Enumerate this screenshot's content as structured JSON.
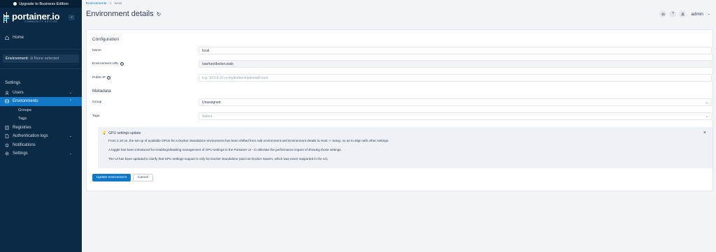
{
  "sidebar": {
    "upgrade_label": "Upgrade to Business Edition",
    "brand": {
      "name": "portainer.io",
      "edition": "COMMUNITY EDITION",
      "collapse_icon": "double-chevron-left-icon"
    },
    "home": "Home",
    "environment_label": "Environment:",
    "environment_value": "None selected",
    "settings_section": "Settings",
    "items": {
      "users": "Users",
      "environments": "Environments",
      "groups": "Groups",
      "tags": "Tags",
      "registries": "Registries",
      "auth_logs": "Authentication logs",
      "notifications": "Notifications",
      "settings": "Settings"
    },
    "active_color": "#1078c7",
    "background_color": "#0a2a46"
  },
  "header": {
    "breadcrumb": {
      "parent": "Environments",
      "separator": ">",
      "current": "local"
    },
    "title": "Environment details",
    "user": "admin"
  },
  "form": {
    "configuration_heading": "Configuration",
    "name_label": "Name",
    "name_value": "local",
    "url_label": "Environment URL",
    "url_value": "/var/run/docker.sock",
    "public_ip_label": "Public IP",
    "public_ip_placeholder": "e.g. 10.0.0.10 or mydocker.mydomain.com",
    "metadata_heading": "Metadata",
    "group_label": "Group",
    "group_value": "Unassigned",
    "tags_label": "Tags",
    "tags_placeholder": "Select..."
  },
  "notice": {
    "title": "GPU settings update",
    "line1": "From 2.18 on, the set-up of available GPUs for a Docker Standalone environment has been shifted from Add environment and Environment details to Host -> Setup, so as to align with other settings.",
    "line2": "A toggle has been introduced for enabling/disabling management of GPU settings in the Portainer UI - to alleviate the performance impact of showing those settings.",
    "line3": "The UI has been updated to clarify that GPU settings support is only for Docker Standalone (and not Docker Swarm, which was never supported in the UI)."
  },
  "actions": {
    "update": "Update environment",
    "cancel": "Cancel"
  }
}
